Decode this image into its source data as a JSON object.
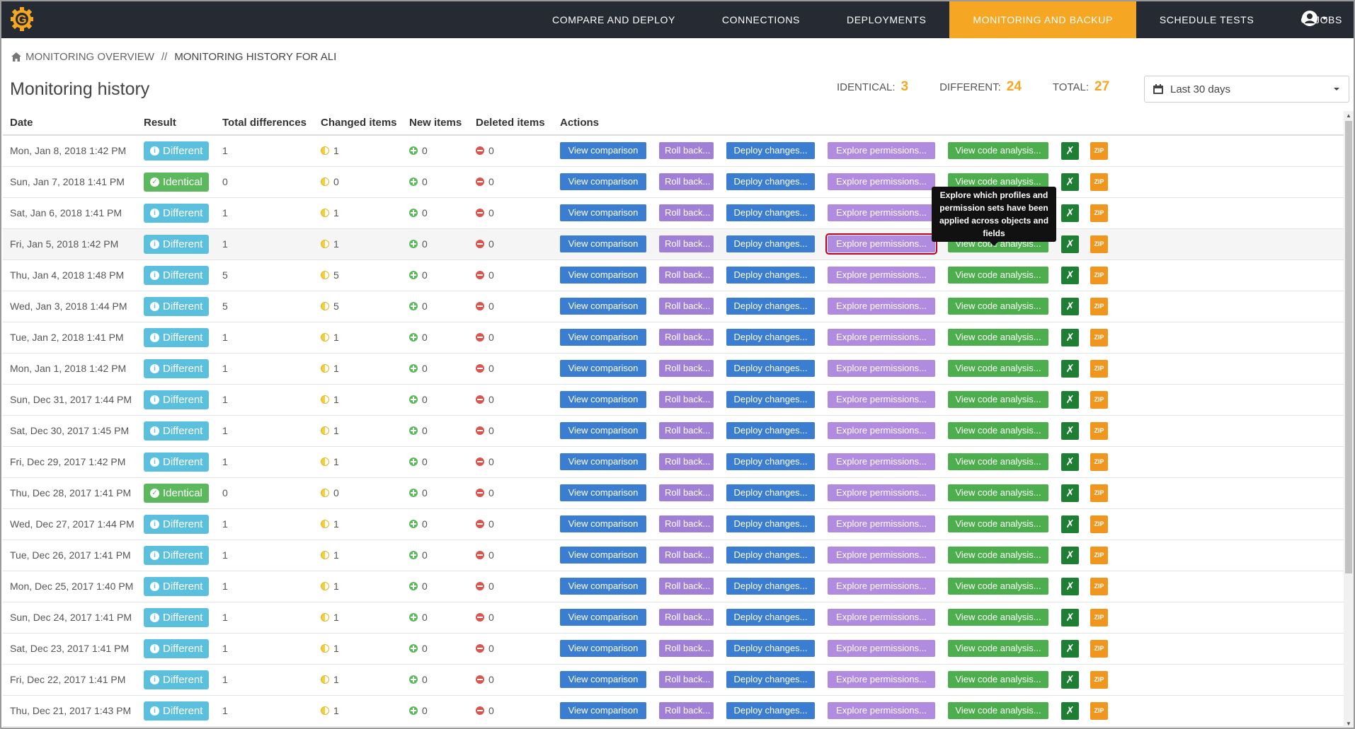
{
  "nav": {
    "logo_letter": "G",
    "items": [
      {
        "label": "COMPARE AND DEPLOY"
      },
      {
        "label": "CONNECTIONS"
      },
      {
        "label": "DEPLOYMENTS"
      },
      {
        "label": "MONITORING AND BACKUP",
        "active": true
      },
      {
        "label": "SCHEDULE TESTS"
      },
      {
        "label": "CI JOBS"
      }
    ],
    "user_icon": "user-circle-icon"
  },
  "breadcrumb": {
    "home": "MONITORING OVERVIEW",
    "separator": "//",
    "current": "MONITORING HISTORY FOR ALI"
  },
  "page": {
    "title": "Monitoring history"
  },
  "stats": {
    "identical_label": "IDENTICAL:",
    "identical_value": "3",
    "different_label": "DIFFERENT:",
    "different_value": "24",
    "total_label": "TOTAL:",
    "total_value": "27"
  },
  "range": {
    "selected": "Last 30 days"
  },
  "table": {
    "headers": {
      "date": "Date",
      "result": "Result",
      "total": "Total differences",
      "changed": "Changed items",
      "new": "New items",
      "deleted": "Deleted items",
      "actions": "Actions"
    },
    "action_labels": {
      "view": "View comparison",
      "roll": "Roll back...",
      "deploy": "Deploy changes...",
      "explore": "Explore permissions...",
      "code": "View code analysis...",
      "zip": "ZIP"
    },
    "rows": [
      {
        "date": "Mon, Jan 8, 2018 1:42 PM",
        "result": "Different",
        "total": "1",
        "changed": "1",
        "new": "0",
        "deleted": "0"
      },
      {
        "date": "Sun, Jan 7, 2018 1:41 PM",
        "result": "Identical",
        "total": "0",
        "changed": "0",
        "new": "0",
        "deleted": "0"
      },
      {
        "date": "Sat, Jan 6, 2018 1:41 PM",
        "result": "Different",
        "total": "1",
        "changed": "1",
        "new": "0",
        "deleted": "0"
      },
      {
        "date": "Fri, Jan 5, 2018 1:42 PM",
        "result": "Different",
        "total": "1",
        "changed": "1",
        "new": "0",
        "deleted": "0"
      },
      {
        "date": "Thu, Jan 4, 2018 1:48 PM",
        "result": "Different",
        "total": "5",
        "changed": "5",
        "new": "0",
        "deleted": "0"
      },
      {
        "date": "Wed, Jan 3, 2018 1:44 PM",
        "result": "Different",
        "total": "5",
        "changed": "5",
        "new": "0",
        "deleted": "0"
      },
      {
        "date": "Tue, Jan 2, 2018 1:41 PM",
        "result": "Different",
        "total": "1",
        "changed": "1",
        "new": "0",
        "deleted": "0"
      },
      {
        "date": "Mon, Jan 1, 2018 1:42 PM",
        "result": "Different",
        "total": "1",
        "changed": "1",
        "new": "0",
        "deleted": "0"
      },
      {
        "date": "Sun, Dec 31, 2017 1:44 PM",
        "result": "Different",
        "total": "1",
        "changed": "1",
        "new": "0",
        "deleted": "0"
      },
      {
        "date": "Sat, Dec 30, 2017 1:45 PM",
        "result": "Different",
        "total": "1",
        "changed": "1",
        "new": "0",
        "deleted": "0"
      },
      {
        "date": "Fri, Dec 29, 2017 1:42 PM",
        "result": "Different",
        "total": "1",
        "changed": "1",
        "new": "0",
        "deleted": "0"
      },
      {
        "date": "Thu, Dec 28, 2017 1:41 PM",
        "result": "Identical",
        "total": "0",
        "changed": "0",
        "new": "0",
        "deleted": "0"
      },
      {
        "date": "Wed, Dec 27, 2017 1:44 PM",
        "result": "Different",
        "total": "1",
        "changed": "1",
        "new": "0",
        "deleted": "0"
      },
      {
        "date": "Tue, Dec 26, 2017 1:41 PM",
        "result": "Different",
        "total": "1",
        "changed": "1",
        "new": "0",
        "deleted": "0"
      },
      {
        "date": "Mon, Dec 25, 2017 1:40 PM",
        "result": "Different",
        "total": "1",
        "changed": "1",
        "new": "0",
        "deleted": "0"
      },
      {
        "date": "Sun, Dec 24, 2017 1:41 PM",
        "result": "Different",
        "total": "1",
        "changed": "1",
        "new": "0",
        "deleted": "0"
      },
      {
        "date": "Sat, Dec 23, 2017 1:41 PM",
        "result": "Different",
        "total": "1",
        "changed": "1",
        "new": "0",
        "deleted": "0"
      },
      {
        "date": "Fri, Dec 22, 2017 1:41 PM",
        "result": "Different",
        "total": "1",
        "changed": "1",
        "new": "0",
        "deleted": "0"
      },
      {
        "date": "Thu, Dec 21, 2017 1:43 PM",
        "result": "Different",
        "total": "1",
        "changed": "1",
        "new": "0",
        "deleted": "0"
      }
    ],
    "highlight_row": 3
  },
  "tooltip": {
    "text": "Explore which profiles and permission sets have been applied across objects and fields"
  },
  "colors": {
    "nav_bg": "#262b33",
    "accent": "#f5a623",
    "different": "#5bc0de",
    "identical": "#5cb85c",
    "view": "#3a7dd1",
    "rollback": "#a07fd6",
    "explore": "#b08be0",
    "code": "#4cae4c",
    "excel": "#1e7e34",
    "zip": "#f0961e"
  }
}
